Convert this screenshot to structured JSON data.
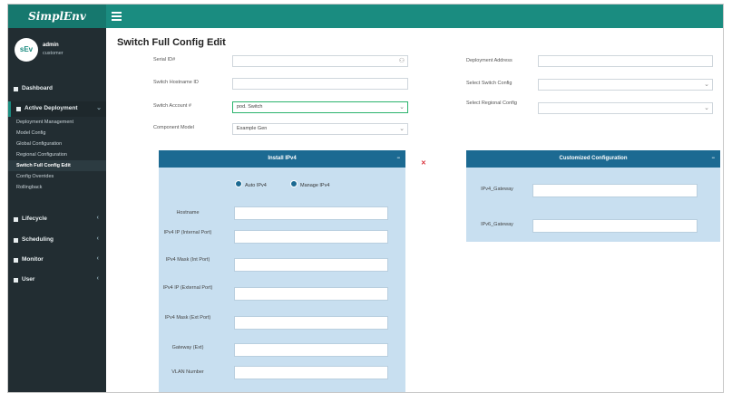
{
  "brand": {
    "logo_text": "SimplEnv"
  },
  "user": {
    "name": "admin",
    "role": "customer",
    "avatar_text": "sEv"
  },
  "sidebar": {
    "items": [
      {
        "label": "Dashboard"
      },
      {
        "label": "Active Deployment"
      },
      {
        "label": "Lifecycle"
      },
      {
        "label": "Scheduling"
      },
      {
        "label": "Monitor"
      },
      {
        "label": "User"
      }
    ],
    "subitems": [
      {
        "label": "Deployment Management"
      },
      {
        "label": "Model Config"
      },
      {
        "label": "Global Configuration"
      },
      {
        "label": "Regional Configuration"
      },
      {
        "label": "Switch Full Config Edit"
      },
      {
        "label": "Config Overrides"
      },
      {
        "label": "Rollingback"
      }
    ]
  },
  "page": {
    "title": "Switch Full Config Edit",
    "fields_left": [
      {
        "label": "Serial ID#",
        "value": ""
      },
      {
        "label": "Switch Hostname ID",
        "value": ""
      },
      {
        "label": "Switch Account #",
        "value": "pod. Switch"
      },
      {
        "label": "Component Model",
        "value": "Example Gen"
      }
    ],
    "fields_right": [
      {
        "label": "Deployment Address",
        "value": ""
      },
      {
        "label": "Select Switch Config",
        "value": ""
      },
      {
        "label": "Select Regional Config",
        "value": ""
      }
    ],
    "left_panel": {
      "title": "Install IPv4",
      "radio_1": "Auto IPv4",
      "radio_2": "Manage IPv4",
      "fields": [
        {
          "label": "Hostname"
        },
        {
          "label": "IPv4 IP (Internal Port)"
        },
        {
          "label": "IPv4 Mask (Int Port)"
        },
        {
          "label": "IPv4 IP (External Port)"
        },
        {
          "label": "IPv4 Mask (Ext Port)"
        },
        {
          "label": "Gateway (Ext)"
        },
        {
          "label": "VLAN Number"
        }
      ]
    },
    "right_panel": {
      "title": "Customized Configuration",
      "fields": [
        {
          "label": "IPv4_Gateway"
        },
        {
          "label": "IPv6_Gateway"
        }
      ]
    }
  }
}
